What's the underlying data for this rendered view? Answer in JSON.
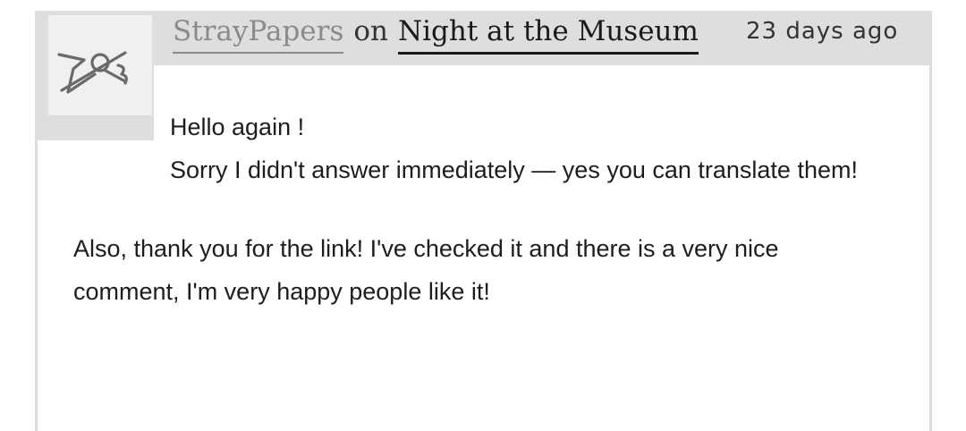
{
  "comment": {
    "author": "StrayPapers",
    "connector": "on",
    "story_title": "Night at the Museum",
    "timestamp": "23 days ago",
    "avatar_icon": "crossed-out-signature-avatar",
    "paragraphs": [
      "Hello again !",
      "Sorry I didn't answer immediately — yes you can translate them!",
      "Also, thank you for the link! I've checked it and there is a very nice comment, I'm very happy people like it!"
    ]
  },
  "colors": {
    "header_bar": "#dedede",
    "author_link": "#8a8a8a",
    "story_link": "#1a1a1a",
    "body_text": "#1d1d1d",
    "card_border": "#dcdcdc"
  }
}
